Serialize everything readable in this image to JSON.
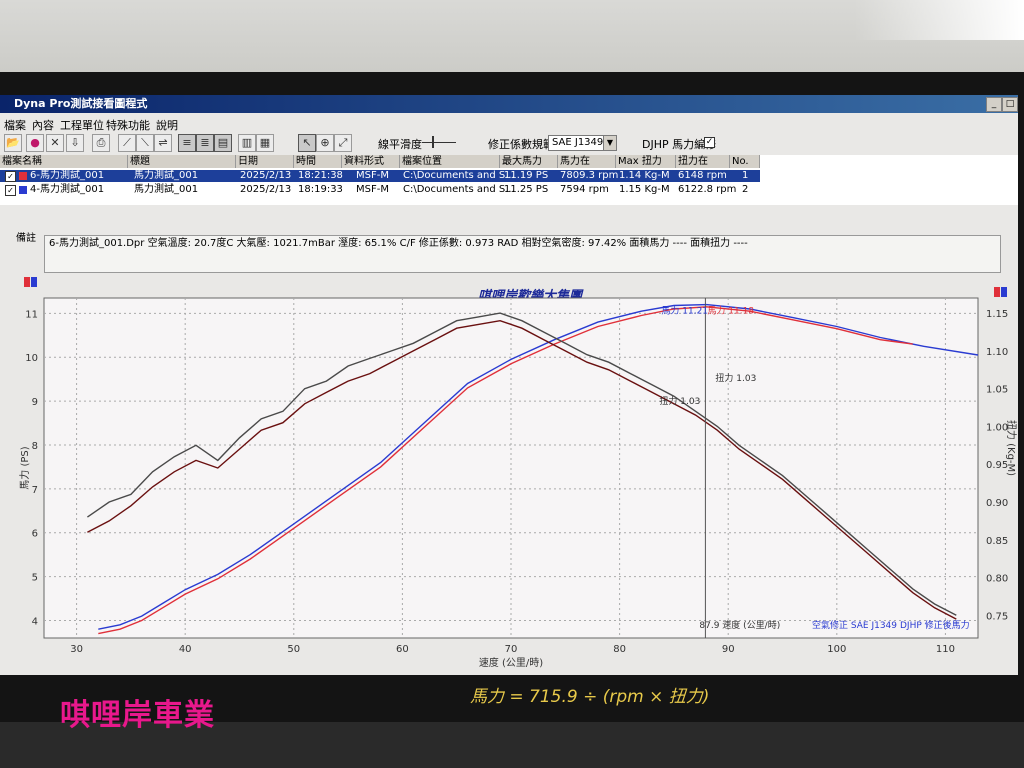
{
  "window": {
    "title": "Dyna Pro測試接看圖程式",
    "control_min": "_",
    "control_max": "□",
    "control_close": "×"
  },
  "menu": [
    "檔案",
    "內容",
    "工程單位",
    "特殊功能",
    "說明"
  ],
  "toolbar": {
    "smoothing_label": "線平滑度",
    "correction_label": "修正係數規範",
    "correction_value": "SAE J1349",
    "djhp_label": "DJHP 馬力編修",
    "djhp_checked": true,
    "icons": [
      "open-icon",
      "stop-icon",
      "delete-icon",
      "download-icon",
      "print-icon",
      "chart-hp-icon",
      "chart-torque-icon",
      "chart-both-icon",
      "layout-1-icon",
      "layout-2-icon",
      "layout-3-icon",
      "layout-4-icon",
      "layout-5-icon",
      "cursor-icon",
      "zoom-icon",
      "expand-icon"
    ]
  },
  "file_table": {
    "headers": [
      "檔案名稱",
      "標題",
      "日期",
      "時間",
      "資料形式",
      "檔案位置",
      "最大馬力",
      "馬力在",
      "Max 扭力",
      "扭力在",
      "No."
    ],
    "rows": [
      {
        "name": "6-馬力測試_001",
        "title": "馬力測試_001",
        "date": "2025/2/13",
        "time": "18:21:38",
        "format": "MSF-M",
        "path": "C:\\Documents and S...",
        "max_hp": "11.19 PS",
        "hp_at": "7809.3 rpm",
        "max_torque": "1.14 Kg-M",
        "torque_at": "6148 rpm",
        "no": "1",
        "color": "#e0303a",
        "selected": true,
        "checked": true
      },
      {
        "name": "4-馬力測試_001",
        "title": "馬力測試_001",
        "date": "2025/2/13",
        "time": "18:19:33",
        "format": "MSF-M",
        "path": "C:\\Documents and S...",
        "max_hp": "11.25 PS",
        "hp_at": "7594 rpm",
        "max_torque": "1.15 Kg-M",
        "torque_at": "6122.8 rpm",
        "no": "2",
        "color": "#2a3bd1",
        "selected": false,
        "checked": true
      }
    ]
  },
  "notes": {
    "label": "備註",
    "text": "6-馬力測試_001.Dpr   空氣溫度: 20.7度C   大氣壓: 1021.7mBar   溼度: 65.1%   C/F 修正係數: 0.973   RAD 相對空氣密度: 97.42%   面積馬力 ----   面積扭力 ----"
  },
  "chart_data": {
    "type": "line",
    "title": "唭哩岸歡樂大集團",
    "xlabel": "速度 (公里/時)",
    "ylabel_left": "馬力 (PS)",
    "ylabel_right": "扭力 (Kg-M)",
    "xlim": [
      27,
      113
    ],
    "ylim_left": [
      3.6,
      11.35
    ],
    "ylim_right": [
      0.72,
      1.17
    ],
    "x_ticks": [
      30,
      40,
      50,
      60,
      70,
      80,
      90,
      100,
      110
    ],
    "y_left_ticks": [
      4,
      5,
      6,
      7,
      8,
      9,
      10,
      11
    ],
    "y_right_ticks": [
      "0.75",
      "0.80",
      "0.85",
      "0.90",
      "0.95",
      "1.00",
      "1.05",
      "1.10",
      "1.15"
    ],
    "grid": true,
    "cursor_x": 87.9,
    "cursor_label": "87.9 速度 (公里/時)",
    "annotations": {
      "hp_blue": "馬力 11.21",
      "hp_red": "馬力 11.18",
      "torque_1": "扭力 1.03",
      "torque_2": "扭力 1.03",
      "footer_left": "空氣修正 SAE J1349",
      "footer_right": "DJHP 修正後馬力"
    },
    "series": [
      {
        "axis": "left",
        "color": "#2a3bd1",
        "x": [
          32,
          34,
          36,
          38,
          40,
          43,
          46,
          50,
          54,
          58,
          62,
          66,
          70,
          74,
          78,
          82,
          85,
          88,
          92,
          96,
          100,
          104,
          108,
          113
        ],
        "values": [
          3.8,
          3.9,
          4.1,
          4.4,
          4.7,
          5.05,
          5.5,
          6.2,
          6.9,
          7.6,
          8.5,
          9.4,
          9.95,
          10.4,
          10.8,
          11.05,
          11.18,
          11.2,
          11.1,
          10.9,
          10.7,
          10.45,
          10.25,
          10.05
        ]
      },
      {
        "axis": "left",
        "color": "#e0303a",
        "x": [
          32,
          34,
          36,
          38,
          40,
          43,
          46,
          50,
          54,
          58,
          62,
          66,
          70,
          74,
          78,
          82,
          85,
          88,
          92,
          96,
          100,
          104,
          107
        ],
        "values": [
          3.7,
          3.8,
          4.0,
          4.3,
          4.6,
          4.95,
          5.4,
          6.1,
          6.8,
          7.5,
          8.4,
          9.3,
          9.85,
          10.3,
          10.7,
          10.95,
          11.1,
          11.15,
          11.05,
          10.85,
          10.65,
          10.4,
          10.3
        ]
      },
      {
        "axis": "right",
        "color": "#4a4a4a",
        "x": [
          31,
          33,
          35,
          37,
          39,
          41,
          43,
          45,
          47,
          49,
          51,
          53,
          55,
          57,
          59,
          61,
          63,
          65,
          67,
          69,
          71,
          73,
          75,
          77,
          79,
          81,
          83,
          85,
          87,
          89,
          91,
          93,
          95,
          97,
          99,
          101,
          103,
          105,
          107,
          109,
          111
        ],
        "values": [
          0.88,
          0.9,
          0.91,
          0.94,
          0.96,
          0.975,
          0.955,
          0.985,
          1.01,
          1.02,
          1.05,
          1.06,
          1.08,
          1.09,
          1.1,
          1.11,
          1.125,
          1.14,
          1.145,
          1.15,
          1.14,
          1.125,
          1.11,
          1.095,
          1.085,
          1.07,
          1.055,
          1.04,
          1.02,
          1.0,
          0.975,
          0.955,
          0.935,
          0.91,
          0.885,
          0.86,
          0.835,
          0.81,
          0.785,
          0.765,
          0.75
        ]
      },
      {
        "axis": "right",
        "color": "#6a1010",
        "x": [
          31,
          33,
          35,
          37,
          39,
          41,
          43,
          45,
          47,
          49,
          51,
          53,
          55,
          57,
          59,
          61,
          63,
          65,
          67,
          69,
          71,
          73,
          75,
          77,
          79,
          81,
          83,
          85,
          87,
          89,
          91,
          93,
          95,
          97,
          99,
          101,
          103,
          105,
          107,
          109,
          111
        ],
        "values": [
          0.86,
          0.875,
          0.895,
          0.92,
          0.94,
          0.955,
          0.945,
          0.97,
          0.995,
          1.005,
          1.03,
          1.045,
          1.06,
          1.07,
          1.085,
          1.1,
          1.115,
          1.13,
          1.135,
          1.14,
          1.13,
          1.115,
          1.1,
          1.085,
          1.075,
          1.06,
          1.045,
          1.03,
          1.015,
          0.995,
          0.97,
          0.95,
          0.93,
          0.905,
          0.88,
          0.855,
          0.83,
          0.805,
          0.78,
          0.76,
          0.745
        ]
      }
    ]
  },
  "photo_overlays": {
    "sticker_text": "唭哩岸車業",
    "handwriting": "馬力 = 715.9 ÷ (rpm × 扭力)"
  }
}
